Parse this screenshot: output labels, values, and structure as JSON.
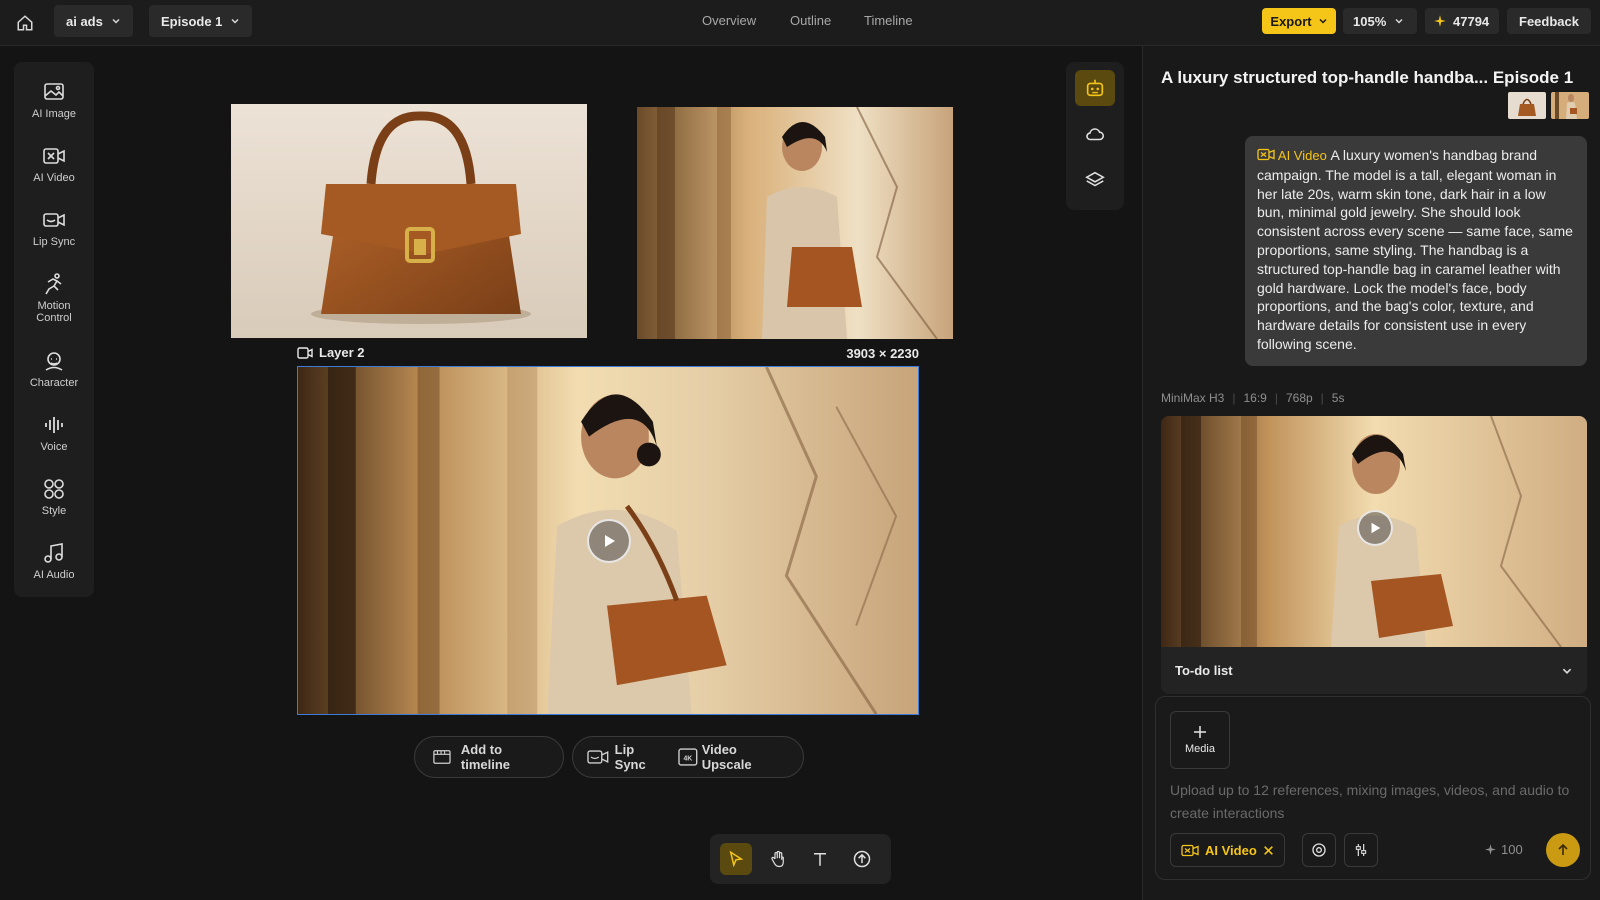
{
  "topbar": {
    "project_name": "ai ads",
    "episode": "Episode 1",
    "tabs": [
      "Overview",
      "Outline",
      "Timeline"
    ],
    "export_label": "Export",
    "zoom": "105%",
    "credits": "47794",
    "feedback_label": "Feedback"
  },
  "sidebar": {
    "tools": [
      {
        "label1": "AI Image",
        "label2": "",
        "icon": "ai-image-icon"
      },
      {
        "label1": "AI Video",
        "label2": "",
        "icon": "ai-video-icon"
      },
      {
        "label1": "Lip Sync",
        "label2": "",
        "icon": "lip-sync-icon"
      },
      {
        "label1": "Motion",
        "label2": "Control",
        "icon": "motion-control-icon"
      },
      {
        "label1": "Character",
        "label2": "",
        "icon": "character-icon"
      },
      {
        "label1": "Voice",
        "label2": "",
        "icon": "voice-icon"
      },
      {
        "label1": "Style",
        "label2": "",
        "icon": "style-icon"
      },
      {
        "label1": "AI Audio",
        "label2": "",
        "icon": "ai-audio-icon"
      }
    ]
  },
  "canvas": {
    "layer_label": "Layer 2",
    "dimensions": "3903 × 2230",
    "actions": {
      "add_to_timeline": "Add to timeline",
      "lip_sync": "Lip Sync",
      "video_upscale": "Video Upscale"
    }
  },
  "panel": {
    "title": "A luxury structured top-handle handba... Episode 1",
    "message_tag": "AI Video",
    "message": "A luxury women's handbag brand campaign. The model is a tall, elegant woman in her late 20s, warm skin tone, dark hair in a low bun, minimal gold jewelry. She should look consistent across every scene — same face, same proportions, same styling. The handbag is a structured top-handle bag in caramel leather with gold hardware. Lock the model's face, body proportions, and the bag's color, texture, and hardware details for consistent use in every following scene.",
    "meta": [
      "MiniMax H3",
      "16:9",
      "768p",
      "5s"
    ],
    "todo_label": "To-do list",
    "media_label": "Media",
    "input_placeholder": "Upload up to 12 references, mixing images, videos, and audio to create interactions",
    "mode_label": "AI Video",
    "cost": "100"
  },
  "colors": {
    "accent": "#f5c518",
    "selection": "#3d7bd9",
    "background": "#141414"
  }
}
